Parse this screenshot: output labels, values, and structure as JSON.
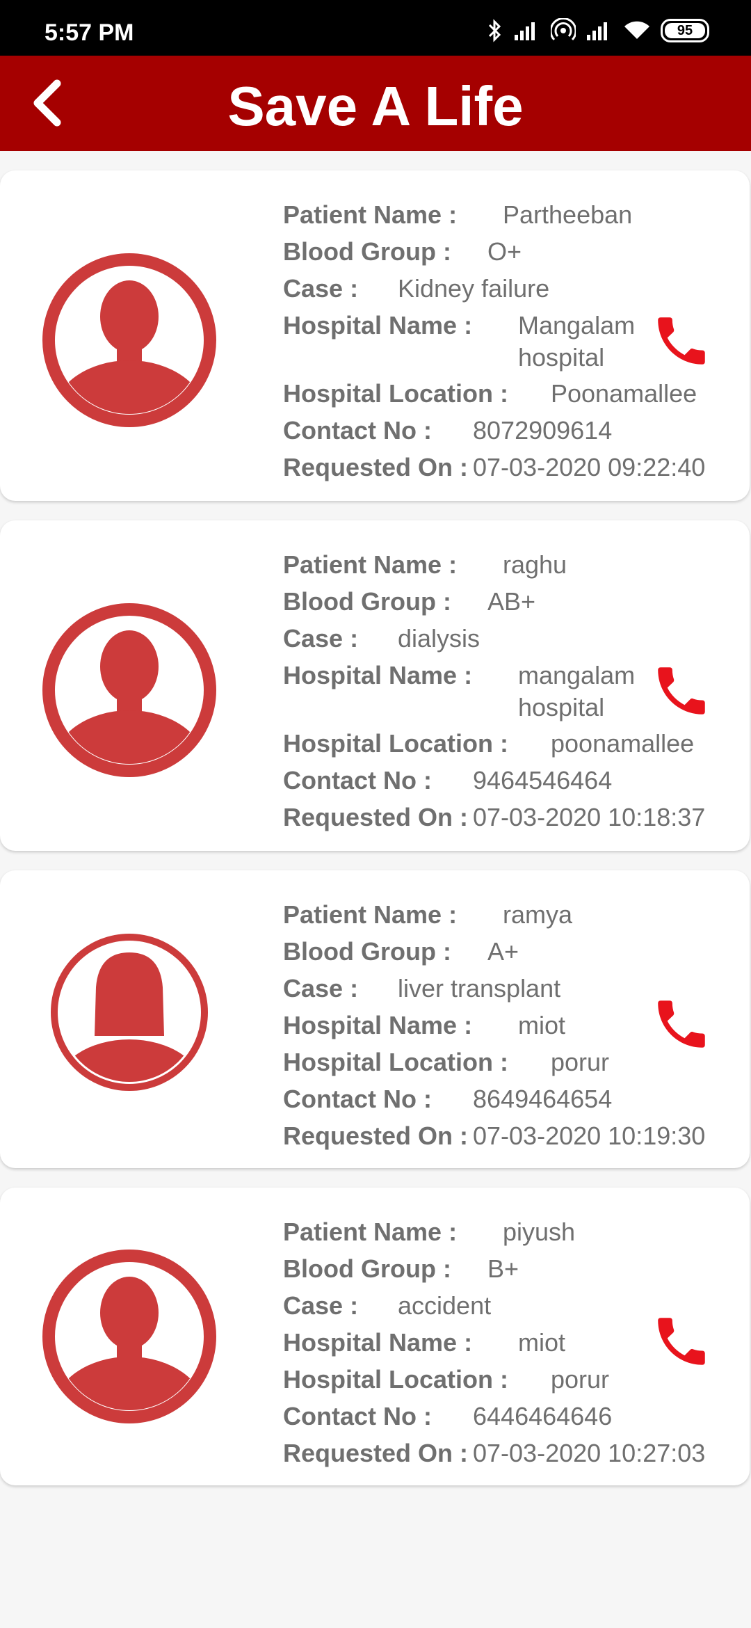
{
  "status_bar": {
    "time": "5:57 PM",
    "battery": "95"
  },
  "app_bar": {
    "title": "Save A Life",
    "back_icon": "chevron-left-icon"
  },
  "labels": {
    "patient_name": "Patient Name :",
    "blood_group": "Blood Group :",
    "case": "Case :",
    "hospital_name": "Hospital Name :",
    "hospital_location": "Hospital Location :",
    "contact_no": "Contact No :",
    "requested_on": "Requested On :"
  },
  "colors": {
    "header": "#a50000",
    "avatar": "#cc3b3b",
    "phone": "#e8131c",
    "text": "#6f6f6f"
  },
  "requests": [
    {
      "avatar": "male-avatar-icon",
      "patient_name": "Partheeban",
      "blood_group": "O+",
      "case": "Kidney failure",
      "hospital_name_1": "Mangalam",
      "hospital_name_2": "hospital",
      "hospital_location": "Poonamallee",
      "contact_no": "8072909614",
      "requested_on": "07-03-2020 09:22:40"
    },
    {
      "avatar": "male-avatar-icon",
      "patient_name": "raghu",
      "blood_group": "AB+",
      "case": "dialysis",
      "hospital_name_1": "mangalam",
      "hospital_name_2": "hospital",
      "hospital_location": "poonamallee",
      "contact_no": "9464546464",
      "requested_on": "07-03-2020 10:18:37"
    },
    {
      "avatar": "female-avatar-icon",
      "patient_name": "ramya",
      "blood_group": "A+",
      "case": "liver transplant",
      "hospital_name_1": "miot",
      "hospital_name_2": "",
      "hospital_location": "porur",
      "contact_no": "8649464654",
      "requested_on": "07-03-2020 10:19:30"
    },
    {
      "avatar": "male-avatar-icon",
      "patient_name": "piyush",
      "blood_group": "B+",
      "case": "accident",
      "hospital_name_1": "miot",
      "hospital_name_2": "",
      "hospital_location": "porur",
      "contact_no": "6446464646",
      "requested_on": "07-03-2020 10:27:03"
    }
  ]
}
